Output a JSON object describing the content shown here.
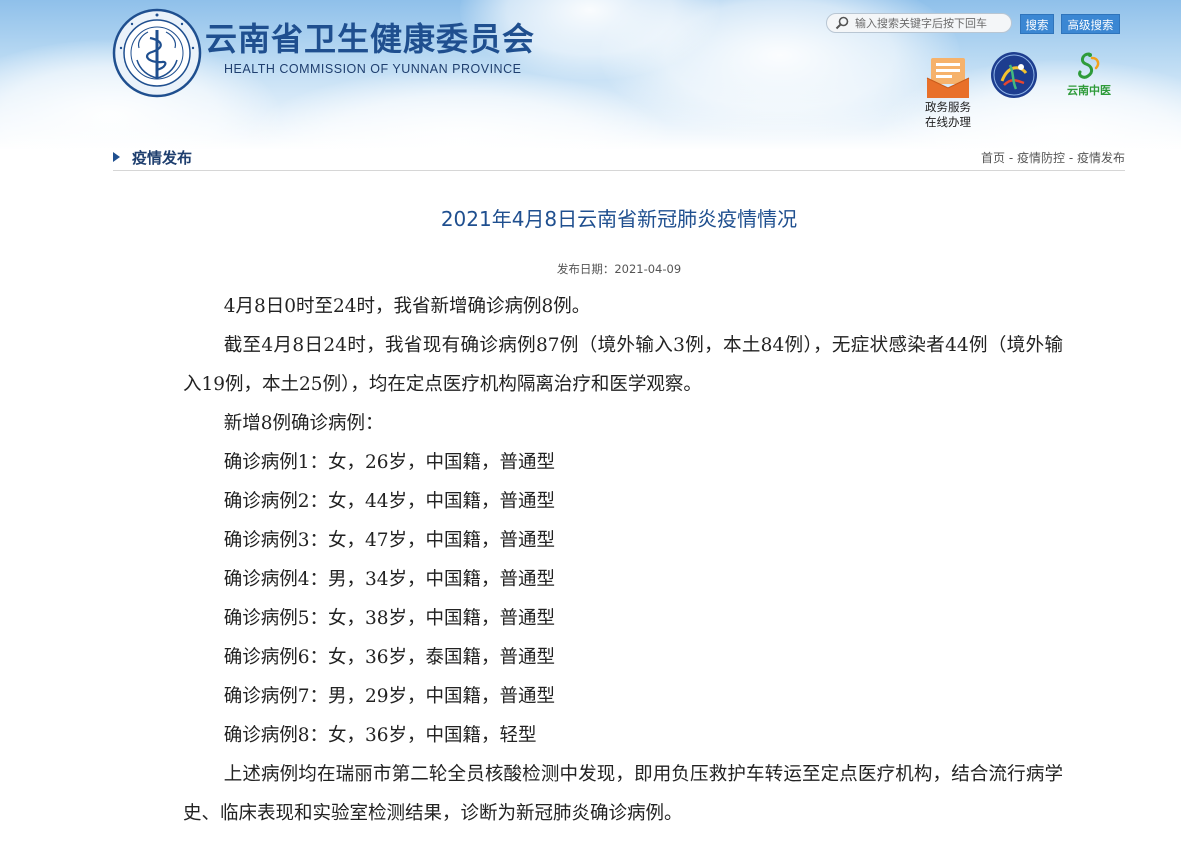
{
  "header": {
    "title": "云南省卫生健康委员会",
    "title_en": "HEALTH COMMISSION OF YUNNAN PROVINCE",
    "search_placeholder": "输入搜索关键字后按下回车",
    "search_button": "搜索",
    "advanced_search_button": "高级搜索",
    "service_label_line1": "政务服务",
    "service_label_line2": "在线办理",
    "tcm_label": "云南中医"
  },
  "section": {
    "title": "疫情发布",
    "breadcrumb": [
      {
        "label": "首页"
      },
      {
        "label": "疫情防控"
      },
      {
        "label": "疫情发布"
      }
    ],
    "breadcrumb_separator": " - "
  },
  "article": {
    "title": "2021年4月8日云南省新冠肺炎疫情情况",
    "publish_date": "发布日期：2021-04-09",
    "paragraphs": [
      "4月8日0时至24时，我省新增确诊病例8例。",
      "截至4月8日24时，我省现有确诊病例87例（境外输入3例，本土84例），无症状感染者44例（境外输入19例，本土25例），均在定点医疗机构隔离治疗和医学观察。",
      "新增8例确诊病例：",
      "确诊病例1：女，26岁，中国籍，普通型",
      "确诊病例2：女，44岁，中国籍，普通型",
      "确诊病例3：女，47岁，中国籍，普通型",
      "确诊病例4：男，34岁，中国籍，普通型",
      "确诊病例5：女，38岁，中国籍，普通型",
      "确诊病例6：女，36岁，泰国籍，普通型",
      "确诊病例7：男，29岁，中国籍，普通型",
      "确诊病例8：女，36岁，中国籍，轻型",
      "上述病例均在瑞丽市第二轮全员核酸检测中发现，即用负压救护车转运至定点医疗机构，结合流行病学史、临床表现和实验室检测结果，诊断为新冠肺炎确诊病例。"
    ]
  },
  "colors": {
    "title_blue": "#1f4f8f",
    "button_blue": "#3b87d3",
    "tcm_green": "#2e9b3a"
  },
  "icons": {
    "logo": "health-commission-logo-icon",
    "search": "search-icon",
    "service": "government-service-icon",
    "emblem": "emblem-icon",
    "tcm": "yunnan-tcm-icon"
  }
}
